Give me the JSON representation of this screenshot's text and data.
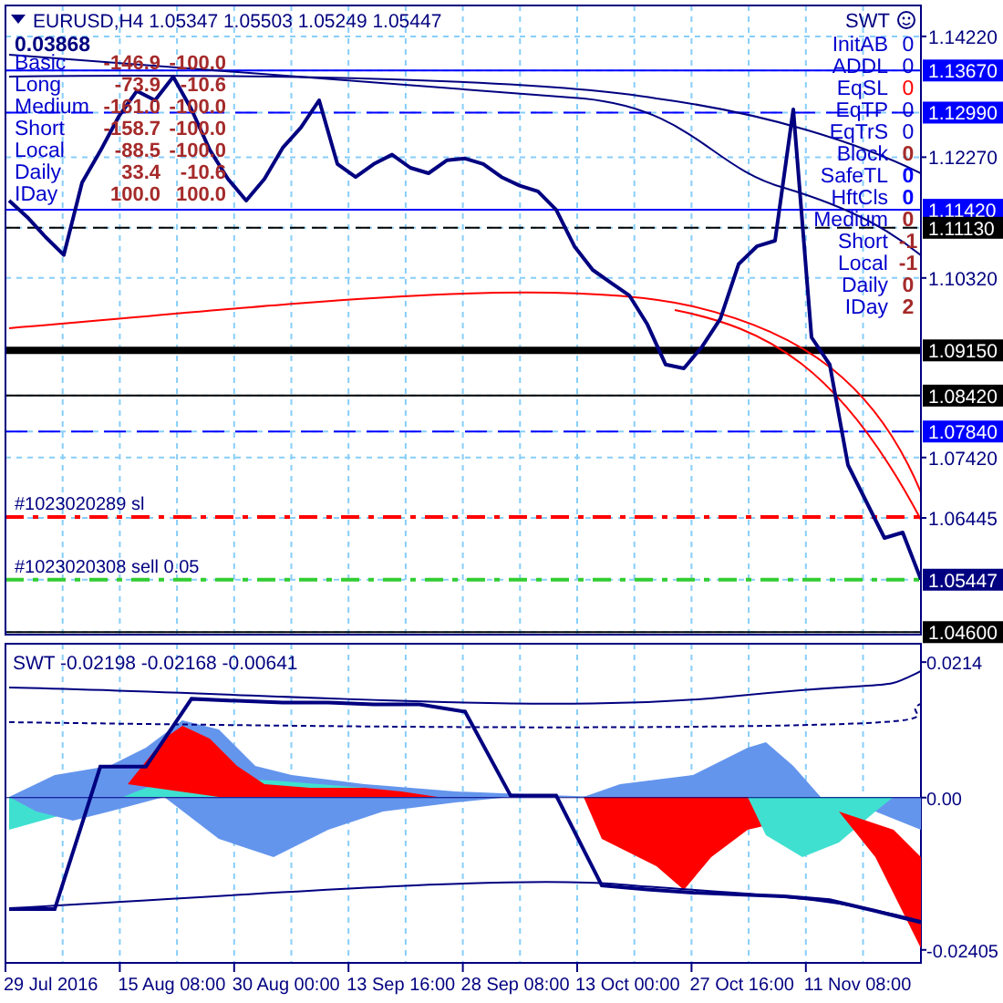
{
  "header": {
    "symbol": "EURUSD,H4 1.05347 1.05503 1.05249 1.05447",
    "value": "0.03868"
  },
  "left_table": [
    {
      "label": "Basic",
      "v1": "-146.9",
      "v2": "-100.0"
    },
    {
      "label": "Long",
      "v1": "-73.9",
      "v2": "-10.6"
    },
    {
      "label": "Medium",
      "v1": "-161.0",
      "v2": "-100.0"
    },
    {
      "label": "Short",
      "v1": "-158.7",
      "v2": "-100.0"
    },
    {
      "label": "Local",
      "v1": "-88.5",
      "v2": "-100.0"
    },
    {
      "label": "Daily",
      "v1": "33.4",
      "v2": "-10.6"
    },
    {
      "label": "IDay",
      "v1": "100.0",
      "v2": "100.0"
    }
  ],
  "right_table": {
    "title": "SWT",
    "rows": [
      {
        "label": "InitAB",
        "value": "0",
        "color": "#0000cd",
        "kind": "plain"
      },
      {
        "label": "ADDL",
        "value": "0",
        "color": "#0000cd",
        "kind": "plain"
      },
      {
        "label": "EqSL",
        "value": "0",
        "color": "#ff0000",
        "kind": "plain"
      },
      {
        "label": "EqTP",
        "value": "0",
        "color": "#0000cd",
        "kind": "plain"
      },
      {
        "label": "EqTrS",
        "value": "0",
        "color": "#0000cd",
        "kind": "plain"
      },
      {
        "label": "Block",
        "value": "0",
        "color": "#a52a2a",
        "kind": "bold"
      },
      {
        "label": "SafeTL",
        "value": "0",
        "color": "#0000ff",
        "kind": "bold"
      },
      {
        "label": "HftCls",
        "value": "0",
        "color": "#0000ff",
        "kind": "bold"
      },
      {
        "label": "Medium",
        "value": "0",
        "color": "#a52a2a",
        "kind": "bold"
      },
      {
        "label": "Short",
        "value": "-1",
        "color": "#a52a2a",
        "kind": "bold"
      },
      {
        "label": "Local",
        "value": "-1",
        "color": "#a52a2a",
        "kind": "bold"
      },
      {
        "label": "Daily",
        "value": "0",
        "color": "#a52a2a",
        "kind": "bold"
      },
      {
        "label": "IDay",
        "value": "2",
        "color": "#a52a2a",
        "kind": "bold"
      }
    ]
  },
  "orders": [
    {
      "label": "#1023020289 sl",
      "kind": "sl"
    },
    {
      "label": "#1023020308 sell 0.05",
      "kind": "entry"
    }
  ],
  "price_axis": [
    {
      "label": "1.13670",
      "kind": "blue"
    },
    {
      "label": "1.12990",
      "kind": "blue"
    },
    {
      "label": "1.11420",
      "kind": "blue"
    },
    {
      "label": "1.11130",
      "kind": "black"
    },
    {
      "label": "1.09150",
      "kind": "black"
    },
    {
      "label": "1.08420",
      "kind": "black"
    },
    {
      "label": "1.07840",
      "kind": "blue"
    },
    {
      "label": "1.05447",
      "kind": "navy"
    },
    {
      "label": "1.04600",
      "kind": "black"
    }
  ],
  "chart_data": {
    "type": "line",
    "ylim": [
      1.0456,
      1.1472
    ],
    "yticks": [
      {
        "value": 1.1422,
        "label": "1.14220"
      },
      {
        "value": 1.1227,
        "label": "1.12270"
      },
      {
        "value": 1.1032,
        "label": "1.10320"
      },
      {
        "value": 1.0742,
        "label": "1.07420"
      },
      {
        "value": 1.06445,
        "label": "1.06445"
      }
    ],
    "series": [
      {
        "color": "#000080",
        "values": [
          1.1157,
          1.113,
          1.1098,
          1.1069,
          1.1186,
          1.1237,
          1.1292,
          1.1334,
          1.1319,
          1.1357,
          1.1304,
          1.1239,
          1.1192,
          1.1157,
          1.1192,
          1.1242,
          1.1275,
          1.1319,
          1.1216,
          1.1195,
          1.1216,
          1.1231,
          1.121,
          1.1201,
          1.1222,
          1.1225,
          1.1216,
          1.1195,
          1.1181,
          1.1172,
          1.1142,
          1.1083,
          1.1045,
          1.1024,
          1.1004,
          1.0957,
          1.0892,
          1.0886,
          1.0921,
          1.0966,
          1.1054,
          1.1083,
          1.1092,
          1.1304,
          1.0936,
          1.0892,
          1.073,
          1.0671,
          1.0612,
          1.0621,
          1.0545
        ]
      }
    ]
  },
  "subwindow": {
    "title": "SWT -0.02198 -0.02168 -0.00641",
    "chart_data": {
      "type": "line",
      "ylim": [
        -0.0261,
        0.0243
      ],
      "yticks": [
        {
          "value": 0.0214,
          "label": "0.0214"
        },
        {
          "value": 0,
          "label": "0.00"
        },
        {
          "value": -0.02405,
          "label": "-0.02405"
        }
      ],
      "series": [
        {
          "color": "#000080",
          "values": [
            -0.0176,
            -0.0176,
            0.0049,
            0.0049,
            0.0156,
            0.0153,
            0.015,
            0.015,
            0.0147,
            0.0147,
            0.0136,
            0.0003,
            0.0003,
            -0.0139,
            -0.0145,
            -0.015,
            -0.0153,
            -0.0156,
            -0.0162,
            -0.0179,
            -0.0197
          ]
        }
      ]
    }
  },
  "time_axis": [
    "29 Jul 2016",
    "15 Aug 08:00",
    "30 Aug 00:00",
    "13 Sep 16:00",
    "28 Sep 08:00",
    "13 Oct 00:00",
    "27 Oct 16:00",
    "11 Nov 08:00"
  ]
}
